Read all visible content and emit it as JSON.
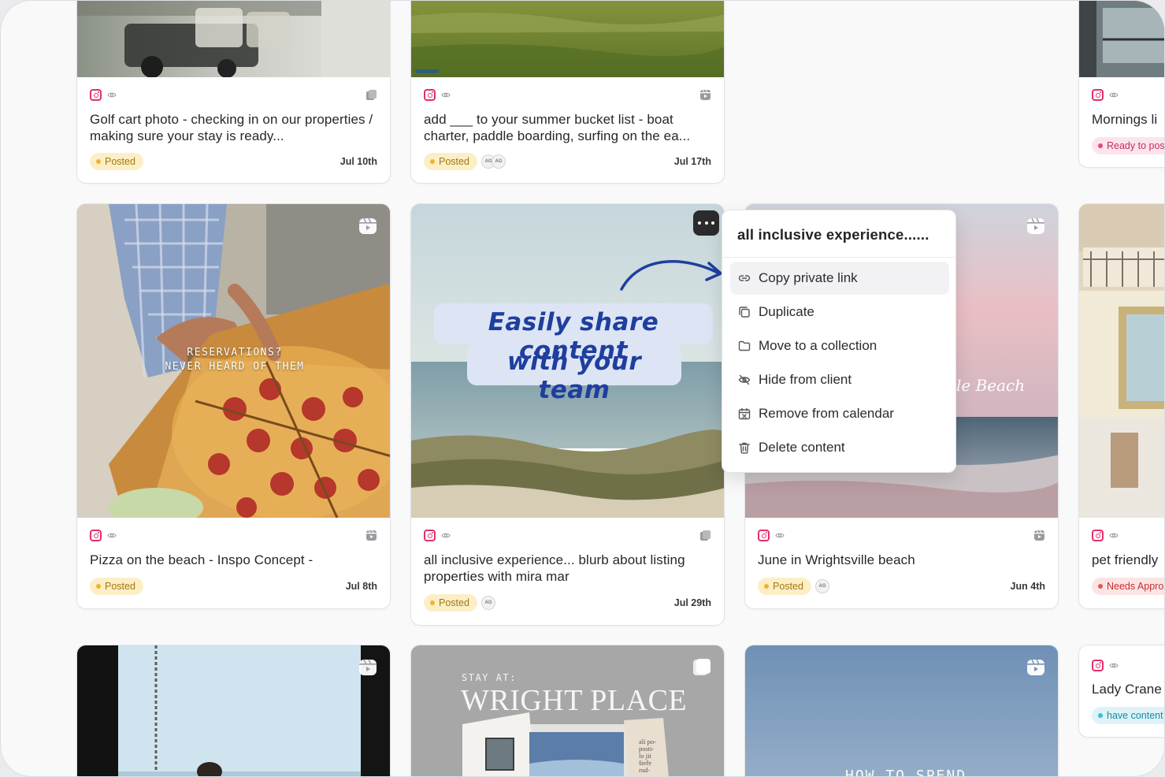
{
  "cards_row1": [
    {
      "title": "Golf cart photo - checking in on our properties / making sure your stay is ready...",
      "status": "Posted",
      "date": "Jul 10th",
      "assignees": [],
      "type_icon": "carousel-icon"
    },
    {
      "title": "add ___ to your summer bucket list - boat charter, paddle boarding, surfing on the ea...",
      "status": "Posted",
      "date": "Jul 17th",
      "assignees": [
        "AG",
        "AG"
      ],
      "type_icon": "reel-icon"
    },
    {
      "title": "Mornings li",
      "status": "Ready to pos",
      "date": "",
      "assignees": [],
      "type_icon": ""
    }
  ],
  "cards_row2": [
    {
      "title": "Pizza on the beach - Inspo Concept -",
      "status": "Posted",
      "date": "Jul 8th",
      "overlay": "RESERVATIONS?\nNEVER HEARD OF THEM",
      "type_icon": "reel-icon"
    },
    {
      "title": "all inclusive experience... blurb about listing properties with mira mar",
      "status": "Posted",
      "date": "Jul 29th",
      "assignees": [
        "AG"
      ],
      "type_icon": "carousel-icon"
    },
    {
      "title": "June in Wrightsville beach",
      "status": "Posted",
      "date": "Jun 4th",
      "assignees": [
        "AG"
      ],
      "overlay": "le Beach",
      "type_icon": "reel-icon"
    },
    {
      "title": "pet friendly",
      "status": "Needs Appro",
      "type_icon": ""
    }
  ],
  "cards_row3": [
    {
      "overlay_small": "STAY AT:",
      "overlay_big": "WRIGHT PLACE",
      "overlay_note": "ali po-\nposti-\nlo jit\nšteře\nrud-"
    },
    {
      "overlay_bottom": "HOW TO SPEND"
    },
    {
      "title": "Lady Crane",
      "status": "have content"
    }
  ],
  "callout": {
    "line1": "Easily share content",
    "line2": "with your team"
  },
  "context_menu": {
    "title": "all inclusive experience......",
    "items": [
      {
        "label": "Copy private link",
        "icon": "link-icon"
      },
      {
        "label": "Duplicate",
        "icon": "duplicate-icon"
      },
      {
        "label": "Move to a collection",
        "icon": "folder-icon"
      },
      {
        "label": "Hide from client",
        "icon": "eye-off-icon"
      },
      {
        "label": "Remove from calendar",
        "icon": "calendar-remove-icon"
      },
      {
        "label": "Delete content",
        "icon": "trash-icon"
      }
    ]
  },
  "colors": {
    "posted_bg": "#fcefc7",
    "posted_text": "#a2780e",
    "instagram": "#e1306c",
    "callout_text": "#1f3f9e",
    "callout_bg": "#dde5f5"
  }
}
